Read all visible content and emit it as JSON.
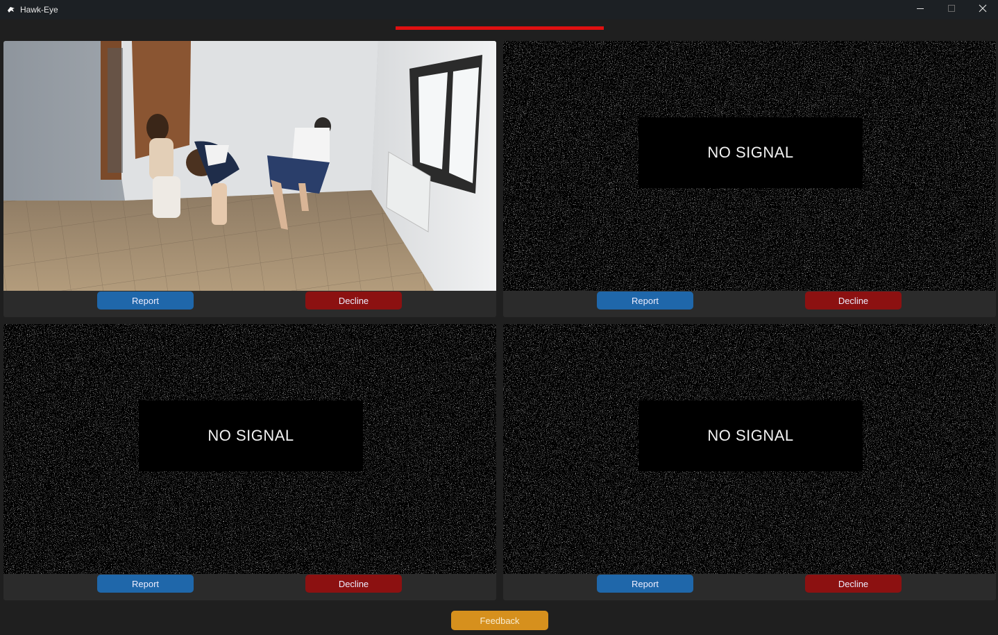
{
  "window": {
    "title": "Hawk-Eye",
    "controls": [
      "minimize-icon",
      "maximize-icon",
      "close-icon"
    ]
  },
  "alert_bar_color": "#e01010",
  "cameras": [
    {
      "status": "live",
      "report_label": "Report",
      "decline_label": "Decline"
    },
    {
      "status": "no-signal",
      "no_signal_text": "NO SIGNAL",
      "report_label": "Report",
      "decline_label": "Decline"
    },
    {
      "status": "no-signal",
      "no_signal_text": "NO SIGNAL",
      "report_label": "Report",
      "decline_label": "Decline"
    },
    {
      "status": "no-signal",
      "no_signal_text": "NO SIGNAL",
      "report_label": "Report",
      "decline_label": "Decline"
    }
  ],
  "feedback_label": "Feedback",
  "colors": {
    "report": "#1f67aa",
    "decline": "#8c1111",
    "feedback": "#d6901d",
    "background": "#1f1f1f"
  }
}
